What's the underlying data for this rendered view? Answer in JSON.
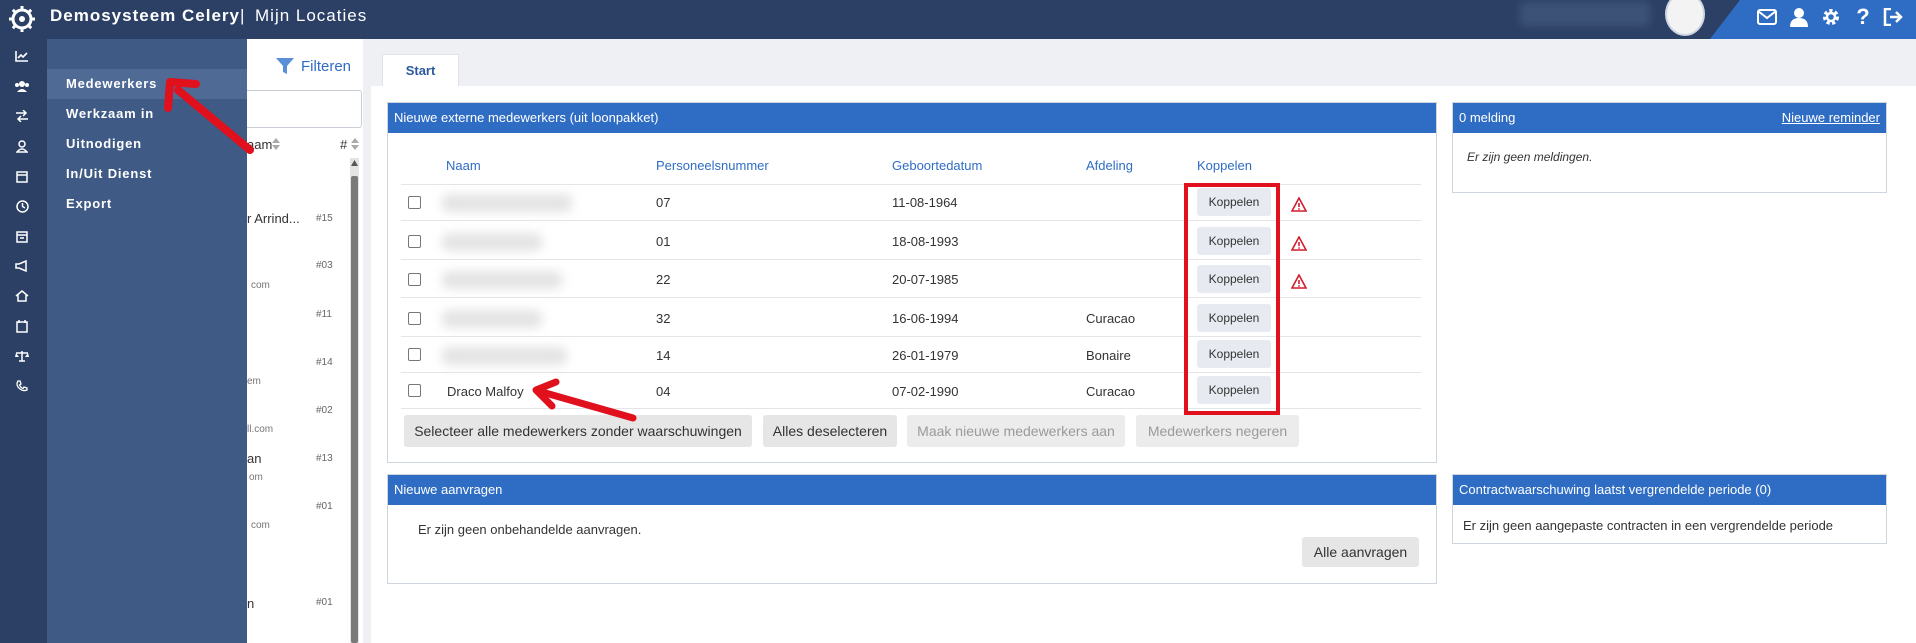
{
  "header": {
    "app_title": "Demosysteem Celery",
    "separator": "|",
    "page_title": "Mijn Locaties"
  },
  "flyout": {
    "items": [
      {
        "label": "Medewerkers"
      },
      {
        "label": "Werkzaam in"
      },
      {
        "label": "Uitnodigen"
      },
      {
        "label": "In/Uit Dienst"
      },
      {
        "label": "Export"
      }
    ]
  },
  "list_panel": {
    "filter_label": "Filteren",
    "col_name_partial": "aam",
    "col_hash": "#",
    "items": [
      {
        "text": "r Arrind...",
        "num": "#15",
        "sub": ""
      },
      {
        "text": "",
        "num": "#03",
        "sub": "com"
      },
      {
        "text": "",
        "num": "#11",
        "sub": ""
      },
      {
        "text": "",
        "num": "#14",
        "sub": "em"
      },
      {
        "text": "",
        "num": "#02",
        "sub": "ll.com"
      },
      {
        "text": "an",
        "num": "#13",
        "sub": "om"
      },
      {
        "text": "",
        "num": "#01",
        "sub": "com"
      },
      {
        "text": "n",
        "num": "#01",
        "sub": ""
      }
    ]
  },
  "tabs": {
    "start": "Start"
  },
  "new_external": {
    "title": "Nieuwe externe medewerkers (uit loonpakket)",
    "columns": [
      "Naam",
      "Personeelsnummer",
      "Geboortedatum",
      "Afdeling",
      "Koppelen"
    ],
    "rows": [
      {
        "name": "",
        "number": "07",
        "birthdate": "11-08-1964",
        "department": "",
        "button": "Koppelen",
        "warning": true
      },
      {
        "name": "",
        "number": "01",
        "birthdate": "18-08-1993",
        "department": "",
        "button": "Koppelen",
        "warning": true
      },
      {
        "name": "",
        "number": "22",
        "birthdate": "20-07-1985",
        "department": "",
        "button": "Koppelen",
        "warning": true
      },
      {
        "name": "",
        "number": "32",
        "birthdate": "16-06-1994",
        "department": "Curacao",
        "button": "Koppelen",
        "warning": false
      },
      {
        "name": "",
        "number": "14",
        "birthdate": "26-01-1979",
        "department": "Bonaire",
        "button": "Koppelen",
        "warning": false
      },
      {
        "name": "Draco Malfoy",
        "number": "04",
        "birthdate": "07-02-1990",
        "department": "Curacao",
        "button": "Koppelen",
        "warning": false
      }
    ],
    "buttons": {
      "select_all": "Selecteer alle medewerkers zonder waarschuwingen",
      "deselect": "Alles deselecteren",
      "create": "Maak nieuwe medewerkers aan",
      "ignore": "Medewerkers negeren"
    }
  },
  "notifications": {
    "title": "0 melding",
    "link": "Nieuwe reminder",
    "empty": "Er zijn geen meldingen."
  },
  "requests": {
    "title": "Nieuwe aanvragen",
    "empty": "Er zijn geen onbehandelde aanvragen.",
    "button": "Alle aanvragen"
  },
  "contract": {
    "title": "Contractwaarschuwing laatst vergrendelde periode (0)",
    "empty": "Er zijn geen aangepaste contracten in een vergrendelde periode"
  },
  "colors": {
    "topbar": "#2c4066",
    "accent": "#2f6dc4",
    "annotation": "#e0101d"
  }
}
